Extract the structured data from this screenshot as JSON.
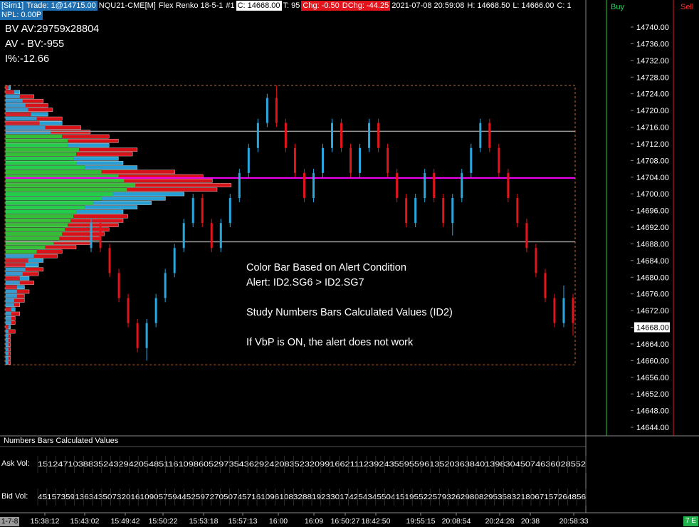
{
  "header": {
    "sim": "[Sim1]",
    "trade": "Trade: 1@14715.00",
    "symbol": "NQU21-CME[M]",
    "chart_type": "Flex Renko 18-5-1",
    "chart_num": "#1",
    "close": "C: 14668.00",
    "ticks": "T: 95",
    "chg": "Chg: -0.50",
    "dchg": "DChg: -44.25",
    "datetime": "2021-07-08 20:59:08",
    "high": "H: 14668.50",
    "low": "L: 14666.00",
    "more": "C: 1"
  },
  "npl": "NPL: 0.00P",
  "stats": {
    "bv_av": "BV AV:29759x28804",
    "av_bv": "AV - BV:-955",
    "pct": "I%:-12.66"
  },
  "notes": {
    "line1": "Color Bar Based on Alert Condition",
    "line2": "Alert: ID2.SG6 > ID2.SG7",
    "line3": "Study Numbers Bars Calculated Values (ID2)",
    "line4": "If VbP is ON, the alert does not work"
  },
  "price_axis": [
    "14740.00",
    "14736.00",
    "14732.00",
    "14728.00",
    "14724.00",
    "14720.00",
    "14716.00",
    "14712.00",
    "14708.00",
    "14704.00",
    "14700.00",
    "14696.00",
    "14692.00",
    "14688.00",
    "14684.00",
    "14680.00",
    "14676.00",
    "14672.00",
    "14668.00",
    "14664.00",
    "14660.00",
    "14656.00",
    "14652.00",
    "14648.00",
    "14644.00"
  ],
  "current_price": "14668.00",
  "dom": {
    "buy": "Buy",
    "sell": "Sell"
  },
  "subgraph": {
    "title": "Numbers Bars Calculated Values",
    "ask_label": "Ask Vol:",
    "bid_label": "Bid Vol:"
  },
  "time_axis": {
    "scale": "1-7-8",
    "ticks": [
      "15:38:12",
      "15:43:02",
      "15:49:42",
      "15:50:22",
      "15:53:18",
      "15:57:13",
      "16:00",
      "16:09",
      "16:50:27",
      "18:42:50",
      "19:55:15",
      "20:08:54",
      "20:24:28",
      "20:38",
      "20:58:33"
    ]
  },
  "status_badge": "7 E",
  "colors": {
    "up": "#29a8e0",
    "down": "#e3141b",
    "vbp_green": "#22d13a",
    "poc": "#ff00ff",
    "value_area_line": "#9a9a9a",
    "dashed_box": "#c4672a"
  },
  "chart_data": {
    "type": "candlestick",
    "price_range": [
      14644,
      14742
    ],
    "last_price": 14668.0,
    "poc_price": 14703.8,
    "value_area_high": 14715.0,
    "value_area_low": 14688.5,
    "bars": [
      {
        "o": 14687,
        "c": 14693,
        "h": 14694,
        "l": 14686
      },
      {
        "o": 14693,
        "c": 14687,
        "h": 14694,
        "l": 14686
      },
      {
        "o": 14687,
        "c": 14681,
        "h": 14688,
        "l": 14680
      },
      {
        "o": 14681,
        "c": 14675,
        "h": 14682,
        "l": 14674
      },
      {
        "o": 14675,
        "c": 14669,
        "h": 14676,
        "l": 14668
      },
      {
        "o": 14669,
        "c": 14663,
        "h": 14670,
        "l": 14662
      },
      {
        "o": 14663,
        "c": 14669,
        "h": 14670,
        "l": 14660
      },
      {
        "o": 14669,
        "c": 14675,
        "h": 14676,
        "l": 14668
      },
      {
        "o": 14675,
        "c": 14681,
        "h": 14682,
        "l": 14674
      },
      {
        "o": 14681,
        "c": 14687,
        "h": 14688,
        "l": 14680
      },
      {
        "o": 14687,
        "c": 14693,
        "h": 14694,
        "l": 14686
      },
      {
        "o": 14693,
        "c": 14699,
        "h": 14700,
        "l": 14692
      },
      {
        "o": 14699,
        "c": 14693,
        "h": 14700,
        "l": 14692
      },
      {
        "o": 14693,
        "c": 14687,
        "h": 14694,
        "l": 14686
      },
      {
        "o": 14687,
        "c": 14693,
        "h": 14694,
        "l": 14686
      },
      {
        "o": 14693,
        "c": 14699,
        "h": 14700,
        "l": 14692
      },
      {
        "o": 14699,
        "c": 14705,
        "h": 14706,
        "l": 14698
      },
      {
        "o": 14705,
        "c": 14711,
        "h": 14712,
        "l": 14704
      },
      {
        "o": 14711,
        "c": 14717,
        "h": 14718,
        "l": 14710
      },
      {
        "o": 14717,
        "c": 14723,
        "h": 14724,
        "l": 14716
      },
      {
        "o": 14723,
        "c": 14717,
        "h": 14726,
        "l": 14716
      },
      {
        "o": 14717,
        "c": 14711,
        "h": 14718,
        "l": 14710
      },
      {
        "o": 14711,
        "c": 14705,
        "h": 14712,
        "l": 14704
      },
      {
        "o": 14705,
        "c": 14699,
        "h": 14706,
        "l": 14698
      },
      {
        "o": 14699,
        "c": 14705,
        "h": 14706,
        "l": 14698
      },
      {
        "o": 14705,
        "c": 14711,
        "h": 14712,
        "l": 14704
      },
      {
        "o": 14711,
        "c": 14717,
        "h": 14718,
        "l": 14710
      },
      {
        "o": 14717,
        "c": 14711,
        "h": 14718,
        "l": 14710
      },
      {
        "o": 14711,
        "c": 14705,
        "h": 14712,
        "l": 14704
      },
      {
        "o": 14705,
        "c": 14711,
        "h": 14712,
        "l": 14704
      },
      {
        "o": 14711,
        "c": 14717,
        "h": 14718,
        "l": 14710
      },
      {
        "o": 14717,
        "c": 14711,
        "h": 14718,
        "l": 14710
      },
      {
        "o": 14711,
        "c": 14705,
        "h": 14712,
        "l": 14704
      },
      {
        "o": 14705,
        "c": 14699,
        "h": 14706,
        "l": 14698
      },
      {
        "o": 14699,
        "c": 14693,
        "h": 14700,
        "l": 14692
      },
      {
        "o": 14693,
        "c": 14699,
        "h": 14700,
        "l": 14692
      },
      {
        "o": 14699,
        "c": 14705,
        "h": 14706,
        "l": 14698
      },
      {
        "o": 14705,
        "c": 14699,
        "h": 14706,
        "l": 14698
      },
      {
        "o": 14699,
        "c": 14693,
        "h": 14700,
        "l": 14692
      },
      {
        "o": 14693,
        "c": 14699,
        "h": 14700,
        "l": 14690
      },
      {
        "o": 14699,
        "c": 14705,
        "h": 14706,
        "l": 14698
      },
      {
        "o": 14705,
        "c": 14711,
        "h": 14712,
        "l": 14704
      },
      {
        "o": 14711,
        "c": 14717,
        "h": 14718,
        "l": 14710
      },
      {
        "o": 14717,
        "c": 14711,
        "h": 14718,
        "l": 14710
      },
      {
        "o": 14711,
        "c": 14705,
        "h": 14712,
        "l": 14704
      },
      {
        "o": 14705,
        "c": 14699,
        "h": 14706,
        "l": 14698
      },
      {
        "o": 14699,
        "c": 14693,
        "h": 14700,
        "l": 14692
      },
      {
        "o": 14693,
        "c": 14687,
        "h": 14694,
        "l": 14686
      },
      {
        "o": 14687,
        "c": 14681,
        "h": 14688,
        "l": 14680
      },
      {
        "o": 14681,
        "c": 14675,
        "h": 14682,
        "l": 14674
      },
      {
        "o": 14675,
        "c": 14669,
        "h": 14676,
        "l": 14668
      },
      {
        "o": 14669,
        "c": 14675,
        "h": 14678,
        "l": 14668
      },
      {
        "o": 14675,
        "c": 14669,
        "h": 14676,
        "l": 14666
      }
    ],
    "vbp_rows": [
      {
        "price": 14726,
        "ask": 2,
        "bid": 1
      },
      {
        "price": 14725,
        "ask": 4,
        "bid": 3
      },
      {
        "price": 14724,
        "ask": 5,
        "bid": 6
      },
      {
        "price": 14723,
        "ask": 6,
        "bid": 8
      },
      {
        "price": 14722,
        "ask": 7,
        "bid": 9
      },
      {
        "price": 14721,
        "ask": 8,
        "bid": 10
      },
      {
        "price": 14720,
        "ask": 10,
        "bid": 9
      },
      {
        "price": 14719,
        "ask": 11,
        "bid": 12
      },
      {
        "price": 14718,
        "ask": 13,
        "bid": 12
      },
      {
        "price": 14717,
        "ask": 14,
        "bid": 16
      },
      {
        "price": 14716,
        "ask": 16,
        "bid": 18
      },
      {
        "price": 14715,
        "ask": 20,
        "bid": 22
      },
      {
        "price": 14714,
        "ask": 22,
        "bid": 24
      },
      {
        "price": 14713,
        "ask": 24,
        "bid": 22
      },
      {
        "price": 14712,
        "ask": 26,
        "bid": 28
      },
      {
        "price": 14711,
        "ask": 25,
        "bid": 27
      },
      {
        "price": 14710,
        "ask": 26,
        "bid": 24
      },
      {
        "price": 14709,
        "ask": 27,
        "bid": 25
      },
      {
        "price": 14708,
        "ask": 30,
        "bid": 28
      },
      {
        "price": 14707,
        "ask": 34,
        "bid": 36
      },
      {
        "price": 14706,
        "ask": 40,
        "bid": 42
      },
      {
        "price": 14705,
        "ask": 42,
        "bid": 44
      },
      {
        "price": 14704,
        "ask": 46,
        "bid": 48
      },
      {
        "price": 14703,
        "ask": 43,
        "bid": 45
      },
      {
        "price": 14702,
        "ask": 40,
        "bid": 38
      },
      {
        "price": 14701,
        "ask": 36,
        "bid": 34
      },
      {
        "price": 14700,
        "ask": 33,
        "bid": 31
      },
      {
        "price": 14699,
        "ask": 30,
        "bid": 28
      },
      {
        "price": 14698,
        "ask": 27,
        "bid": 25
      },
      {
        "price": 14697,
        "ask": 24,
        "bid": 26
      },
      {
        "price": 14696,
        "ask": 23,
        "bid": 25
      },
      {
        "price": 14695,
        "ask": 22,
        "bid": 24
      },
      {
        "price": 14694,
        "ask": 21,
        "bid": 22
      },
      {
        "price": 14693,
        "ask": 20,
        "bid": 21
      },
      {
        "price": 14692,
        "ask": 19,
        "bid": 20
      },
      {
        "price": 14691,
        "ask": 17,
        "bid": 18
      },
      {
        "price": 14690,
        "ask": 14,
        "bid": 15
      },
      {
        "price": 14689,
        "ask": 11,
        "bid": 12
      },
      {
        "price": 14688,
        "ask": 10,
        "bid": 11
      },
      {
        "price": 14687,
        "ask": 9,
        "bid": 8
      },
      {
        "price": 14686,
        "ask": 8,
        "bid": 7
      },
      {
        "price": 14685,
        "ask": 7,
        "bid": 8
      },
      {
        "price": 14684,
        "ask": 6,
        "bid": 7
      },
      {
        "price": 14683,
        "ask": 6,
        "bid": 5
      },
      {
        "price": 14682,
        "ask": 5,
        "bid": 6
      },
      {
        "price": 14681,
        "ask": 5,
        "bid": 4
      },
      {
        "price": 14680,
        "ask": 4,
        "bid": 5
      },
      {
        "price": 14679,
        "ask": 4,
        "bid": 4
      },
      {
        "price": 14678,
        "ask": 3,
        "bid": 4
      },
      {
        "price": 14677,
        "ask": 3,
        "bid": 3
      },
      {
        "price": 14676,
        "ask": 3,
        "bid": 2
      },
      {
        "price": 14675,
        "ask": 2,
        "bid": 3
      },
      {
        "price": 14674,
        "ask": 2,
        "bid": 2
      },
      {
        "price": 14673,
        "ask": 2,
        "bid": 2
      },
      {
        "price": 14672,
        "ask": 2,
        "bid": 1
      },
      {
        "price": 14671,
        "ask": 1,
        "bid": 2
      },
      {
        "price": 14670,
        "ask": 1,
        "bid": 1
      },
      {
        "price": 14669,
        "ask": 1,
        "bid": 1
      },
      {
        "price": 14668,
        "ask": 1,
        "bid": 1
      },
      {
        "price": 14667,
        "ask": 1,
        "bid": 1
      },
      {
        "price": 14666,
        "ask": 1,
        "bid": 1
      },
      {
        "price": 14665,
        "ask": 1,
        "bid": 1
      },
      {
        "price": 14664,
        "ask": 1,
        "bid": 1
      }
    ]
  }
}
